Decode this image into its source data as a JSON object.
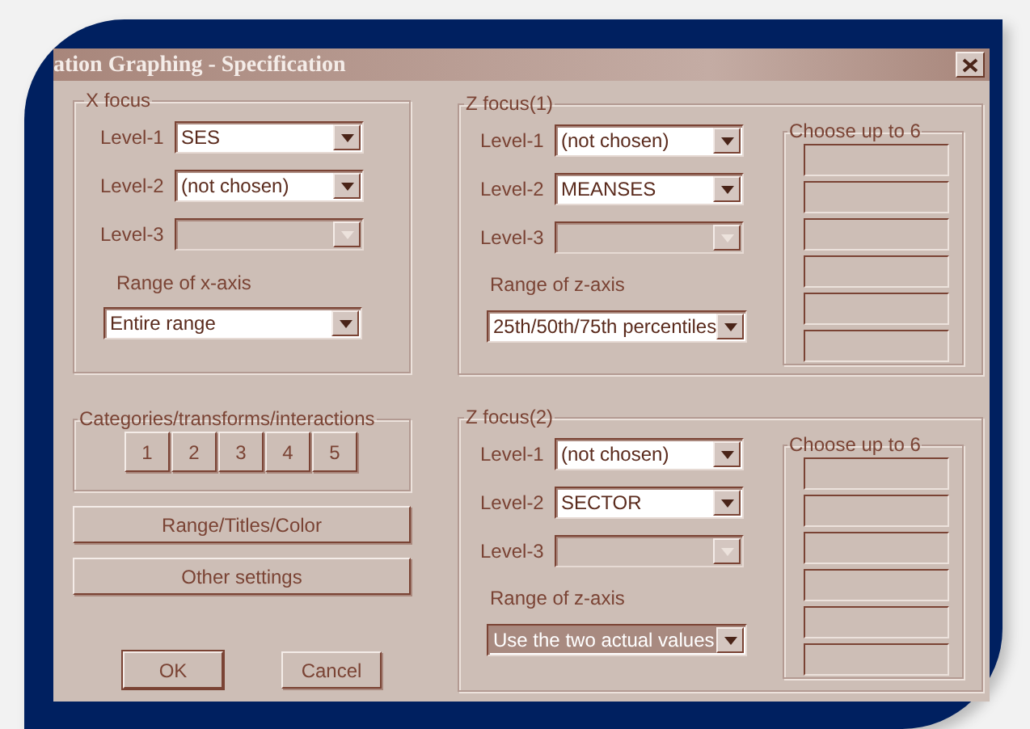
{
  "window": {
    "title": "ation Graphing - Specification"
  },
  "x_focus": {
    "title": "X focus",
    "levels": [
      {
        "label": "Level-1",
        "value": "SES",
        "disabled": false
      },
      {
        "label": "Level-2",
        "value": "(not chosen)",
        "disabled": false
      },
      {
        "label": "Level-3",
        "disabled": true
      }
    ],
    "range_label": "Range of x-axis",
    "range": {
      "value": "Entire range",
      "highlighted": false
    }
  },
  "categories": {
    "title": "Categories/transforms/interactions",
    "buttons": [
      "1",
      "2",
      "3",
      "4",
      "5"
    ]
  },
  "buttons": [
    "Range/Titles/Color",
    "Other settings"
  ],
  "footer_buttons": [
    {
      "label": "OK",
      "default": true
    },
    {
      "label": "Cancel",
      "default": false
    }
  ],
  "z_focus": [
    {
      "title": "Z focus(1)",
      "levels": [
        {
          "label": "Level-1",
          "value": "(not chosen)",
          "disabled": false
        },
        {
          "label": "Level-2",
          "value": "MEANSES",
          "disabled": false
        },
        {
          "label": "Level-3",
          "disabled": true
        }
      ],
      "range_label": "Range of z-axis",
      "range": {
        "value": "25th/50th/75th percentiles",
        "highlighted": false
      },
      "choose": {
        "title": "Choose up to 6",
        "slots": [
          {
            "filled": false
          },
          {
            "filled": false
          },
          {
            "filled": false
          },
          {
            "filled": false
          },
          {
            "filled": false
          },
          {
            "filled": false
          }
        ]
      }
    },
    {
      "title": "Z focus(2)",
      "levels": [
        {
          "label": "Level-1",
          "value": "(not chosen)",
          "disabled": false
        },
        {
          "label": "Level-2",
          "value": "SECTOR",
          "disabled": false
        },
        {
          "label": "Level-3",
          "disabled": true
        }
      ],
      "range_label": "Range of z-axis",
      "range": {
        "value": "Use the two actual values",
        "highlighted": true
      },
      "choose": {
        "title": "Choose up to 6",
        "slots": [
          {
            "filled": false
          },
          {
            "filled": false
          },
          {
            "filled": false
          },
          {
            "filled": false
          },
          {
            "filled": false
          },
          {
            "filled": false
          }
        ]
      }
    }
  ]
}
